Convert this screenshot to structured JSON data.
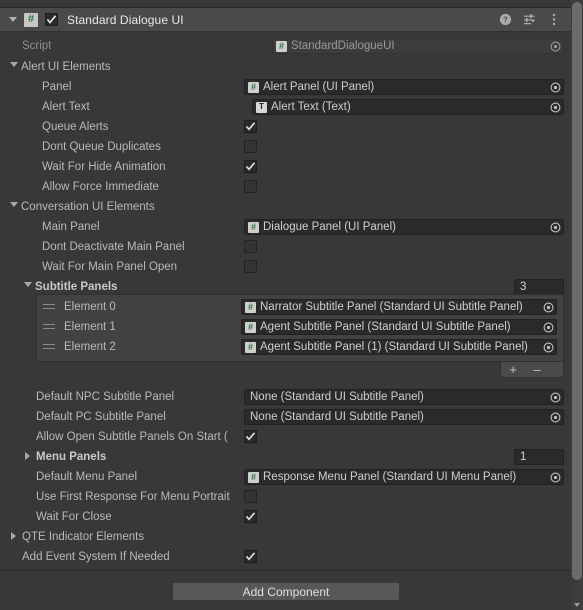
{
  "window": {
    "background": "#383838",
    "panel_background": "#383838"
  },
  "component_header": {
    "title": "Standard Dialogue UI",
    "enabled": true,
    "expanded": true,
    "script_badge": "csharp-script-icon",
    "icons": [
      {
        "name": "help-icon",
        "glyph": "?"
      },
      {
        "name": "preset-icon",
        "glyph": "sliders"
      },
      {
        "name": "more-menu-icon",
        "glyph": "kebab"
      }
    ]
  },
  "script_row": {
    "label": "Script",
    "value": "StandardDialogueUI",
    "icon": "csharp-script-icon",
    "disabled": true
  },
  "sections": {
    "alert": {
      "label": "Alert UI Elements",
      "expanded": true,
      "rows": [
        {
          "label": "Panel",
          "type": "object",
          "value": "Alert Panel (UI Panel)",
          "icon": "script"
        },
        {
          "label": "Alert Text",
          "type": "object",
          "value": "Alert Text (Text)",
          "icon": "text"
        },
        {
          "label": "Queue Alerts",
          "type": "bool",
          "value": true
        },
        {
          "label": "Dont Queue Duplicates",
          "type": "bool",
          "value": false
        },
        {
          "label": "Wait For Hide Animation",
          "type": "bool",
          "value": true
        },
        {
          "label": "Allow Force Immediate",
          "type": "bool",
          "value": false
        }
      ]
    },
    "conversation": {
      "label": "Conversation UI Elements",
      "expanded": true,
      "rows": [
        {
          "label": "Main Panel",
          "type": "object",
          "value": "Dialogue Panel (UI Panel)",
          "icon": "script"
        },
        {
          "label": "Dont Deactivate Main Panel",
          "type": "bool",
          "value": false
        },
        {
          "label": "Wait For Main Panel Open",
          "type": "bool",
          "value": false
        }
      ]
    },
    "subtitle_panels": {
      "label": "Subtitle Panels",
      "expanded": true,
      "size": "3",
      "elements": [
        {
          "label": "Element 0",
          "value": "Narrator Subtitle Panel (Standard UI Subtitle Panel)",
          "icon": "script"
        },
        {
          "label": "Element 1",
          "value": "Agent Subtitle Panel (Standard UI Subtitle Panel)",
          "icon": "script"
        },
        {
          "label": "Element 2",
          "value": "Agent Subtitle Panel (1) (Standard UI Subtitle Panel)",
          "icon": "script"
        }
      ],
      "add_label": "+",
      "remove_label": "–"
    },
    "after_list_rows": [
      {
        "label": "Default NPC Subtitle Panel",
        "type": "object",
        "value": "None (Standard UI Subtitle Panel)",
        "icon": "none"
      },
      {
        "label": "Default PC Subtitle Panel",
        "type": "object",
        "value": "None (Standard UI Subtitle Panel)",
        "icon": "none"
      },
      {
        "label": "Allow Open Subtitle Panels On Start (",
        "type": "bool",
        "value": true
      }
    ],
    "menu_panels": {
      "label": "Menu Panels",
      "expanded": false,
      "size": "1"
    },
    "menu_rows": [
      {
        "label": "Default Menu Panel",
        "type": "object",
        "value": "Response Menu Panel (Standard UI Menu Panel)",
        "icon": "script"
      },
      {
        "label": "Use First Response For Menu Portrait",
        "type": "bool",
        "value": false
      },
      {
        "label": "Wait For Close",
        "type": "bool",
        "value": true
      }
    ],
    "qte": {
      "label": "QTE Indicator Elements",
      "expanded": false
    },
    "final_rows": [
      {
        "label": "Add Event System If Needed",
        "type": "bool",
        "value": true
      }
    ]
  },
  "footer": {
    "add_component_label": "Add Component"
  }
}
